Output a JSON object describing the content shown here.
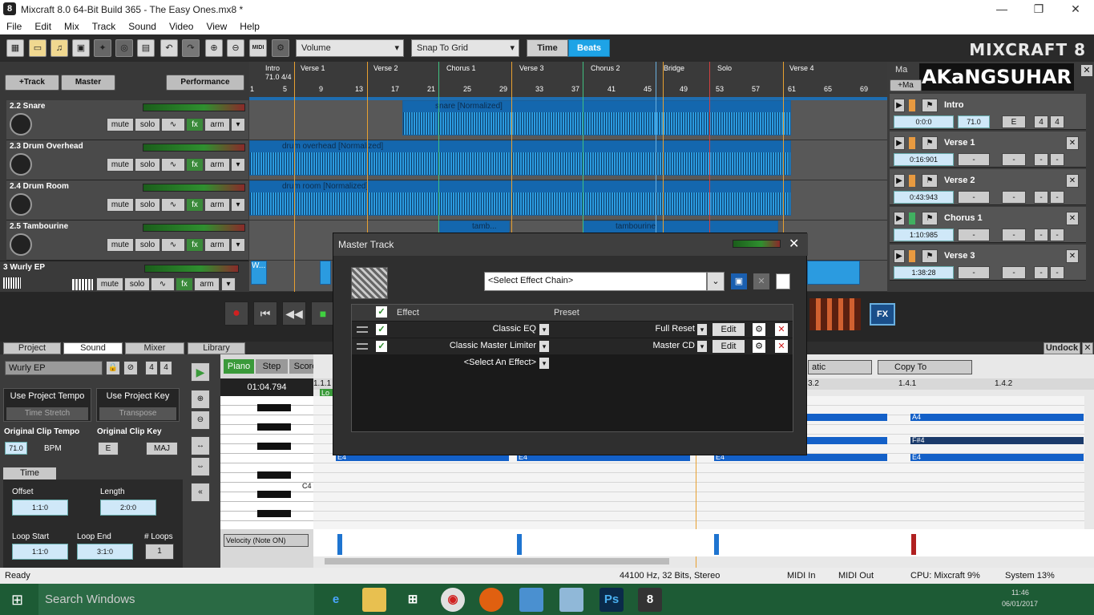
{
  "window": {
    "title": "Mixcraft 8.0 64-Bit Build 365 - The Easy Ones.mx8 *",
    "logo": "8",
    "minimize": "—",
    "maximize": "❐",
    "close": "✕"
  },
  "menu": [
    "File",
    "Edit",
    "Mix",
    "Track",
    "Sound",
    "Video",
    "View",
    "Help"
  ],
  "toolbar": {
    "view_dropdown": "Volume",
    "snap_dropdown": "Snap To Grid",
    "time_label": "Time",
    "beats_label": "Beats",
    "brand": "MIXCRAFT 8",
    "midi_label": "MIDI"
  },
  "trackpanel": {
    "add_track": "+Track",
    "master": "Master",
    "performance": "Performance"
  },
  "tracks": [
    {
      "name": "2.2 Snare"
    },
    {
      "name": "2.3 Drum Overhead"
    },
    {
      "name": "2.4 Drum Room"
    },
    {
      "name": "2.5 Tambourine"
    }
  ],
  "wurly_track": {
    "name": "3 Wurly EP"
  },
  "track_buttons": {
    "mute": "mute",
    "solo": "solo",
    "fx": "fx",
    "arm": "arm"
  },
  "ruler": {
    "tempo": "71.0 4/4",
    "markers": [
      "Intro",
      "Verse 1",
      "Verse 2",
      "Chorus 1",
      "Verse 3",
      "Chorus 2",
      "Bridge",
      "Solo",
      "Verse 4"
    ],
    "bars": [
      "1",
      "5",
      "9",
      "13",
      "17",
      "21",
      "25",
      "29",
      "33",
      "37",
      "41",
      "45",
      "49",
      "53",
      "57",
      "61",
      "65",
      "69"
    ]
  },
  "clips": {
    "snare": "snare [Normalized]",
    "overhead": "drum overhead [Normalized]",
    "room": "drum room [Normalized]",
    "tamb1": "tamb...",
    "tamb2": "tambourine",
    "wurly": "W..."
  },
  "markers_panel": {
    "tab": "Ma",
    "brand": "AKaNGSUHAR",
    "add": "+Ma",
    "sections": [
      {
        "name": "Intro",
        "time": "0:0:0",
        "tempo": "71.0",
        "key": "E",
        "sig1": "4",
        "sig2": "4"
      },
      {
        "name": "Verse 1",
        "time": "0:16:901",
        "tempo": "-",
        "key": "-",
        "sig1": "-",
        "sig2": "-"
      },
      {
        "name": "Verse 2",
        "time": "0:43:943",
        "tempo": "-",
        "key": "-",
        "sig1": "-",
        "sig2": "-"
      },
      {
        "name": "Chorus 1",
        "time": "1:10:985",
        "tempo": "-",
        "key": "-",
        "sig1": "-",
        "sig2": "-"
      },
      {
        "name": "Verse 3",
        "time": "1:38:28",
        "tempo": "-",
        "key": "-",
        "sig1": "-",
        "sig2": "-"
      }
    ]
  },
  "tabs": {
    "project": "Project",
    "sound": "Sound",
    "mixer": "Mixer",
    "library": "Library",
    "undock": "Undock"
  },
  "sound_panel": {
    "instrument": "Wurly EP",
    "num1": "4",
    "num2": "4",
    "use_tempo": "Use Project Tempo",
    "time_stretch": "Time Stretch",
    "use_key": "Use Project Key",
    "transpose": "Transpose",
    "orig_tempo_label": "Original Clip Tempo",
    "orig_tempo": "71.0",
    "bpm": "BPM",
    "orig_key_label": "Original Clip Key",
    "orig_key": "E",
    "orig_mode": "MAJ",
    "time_tab": "Time",
    "offset_label": "Offset",
    "offset": "1:1:0",
    "length_label": "Length",
    "length": "2:0:0",
    "loop_start_label": "Loop Start",
    "loop_start": "1:1:0",
    "loop_end_label": "Loop End",
    "loop_end": "3:1:0",
    "loops_label": "# Loops",
    "loops": "1"
  },
  "editor": {
    "piano": "Piano",
    "step": "Step",
    "score": "Score",
    "time": "01:04.794",
    "pos": "1.1.1",
    "loop_label": "Lo",
    "c4": "C4",
    "velocity": "Velocity (Note ON)",
    "chromatic": "atic",
    "copy_to": "Copy To",
    "ruler": [
      "3.2",
      "1.4.1",
      "1.4.2"
    ],
    "notes": [
      "E4",
      "E4",
      "E4",
      "E4",
      "A4",
      "F#4"
    ]
  },
  "dialog": {
    "title": "Master Track",
    "chain_select": "<Select Effect Chain>",
    "col_effect": "Effect",
    "col_preset": "Preset",
    "effects": [
      {
        "name": "Classic EQ",
        "preset": "Full Reset",
        "edit": "Edit"
      },
      {
        "name": "Classic Master Limiter",
        "preset": "Master CD",
        "edit": "Edit"
      }
    ],
    "select_effect": "<Select An Effect>",
    "close": "✕"
  },
  "transport": {
    "fx": "FX"
  },
  "status": {
    "ready": "Ready",
    "audio": "44100 Hz, 32 Bits, Stereo",
    "midi_in": "MIDI In",
    "midi_out": "MIDI Out",
    "cpu": "CPU: Mixcraft 9%",
    "system": "System 13%"
  },
  "taskbar": {
    "search": "Search Windows",
    "time": "11:46",
    "date": "06/01/2017"
  }
}
